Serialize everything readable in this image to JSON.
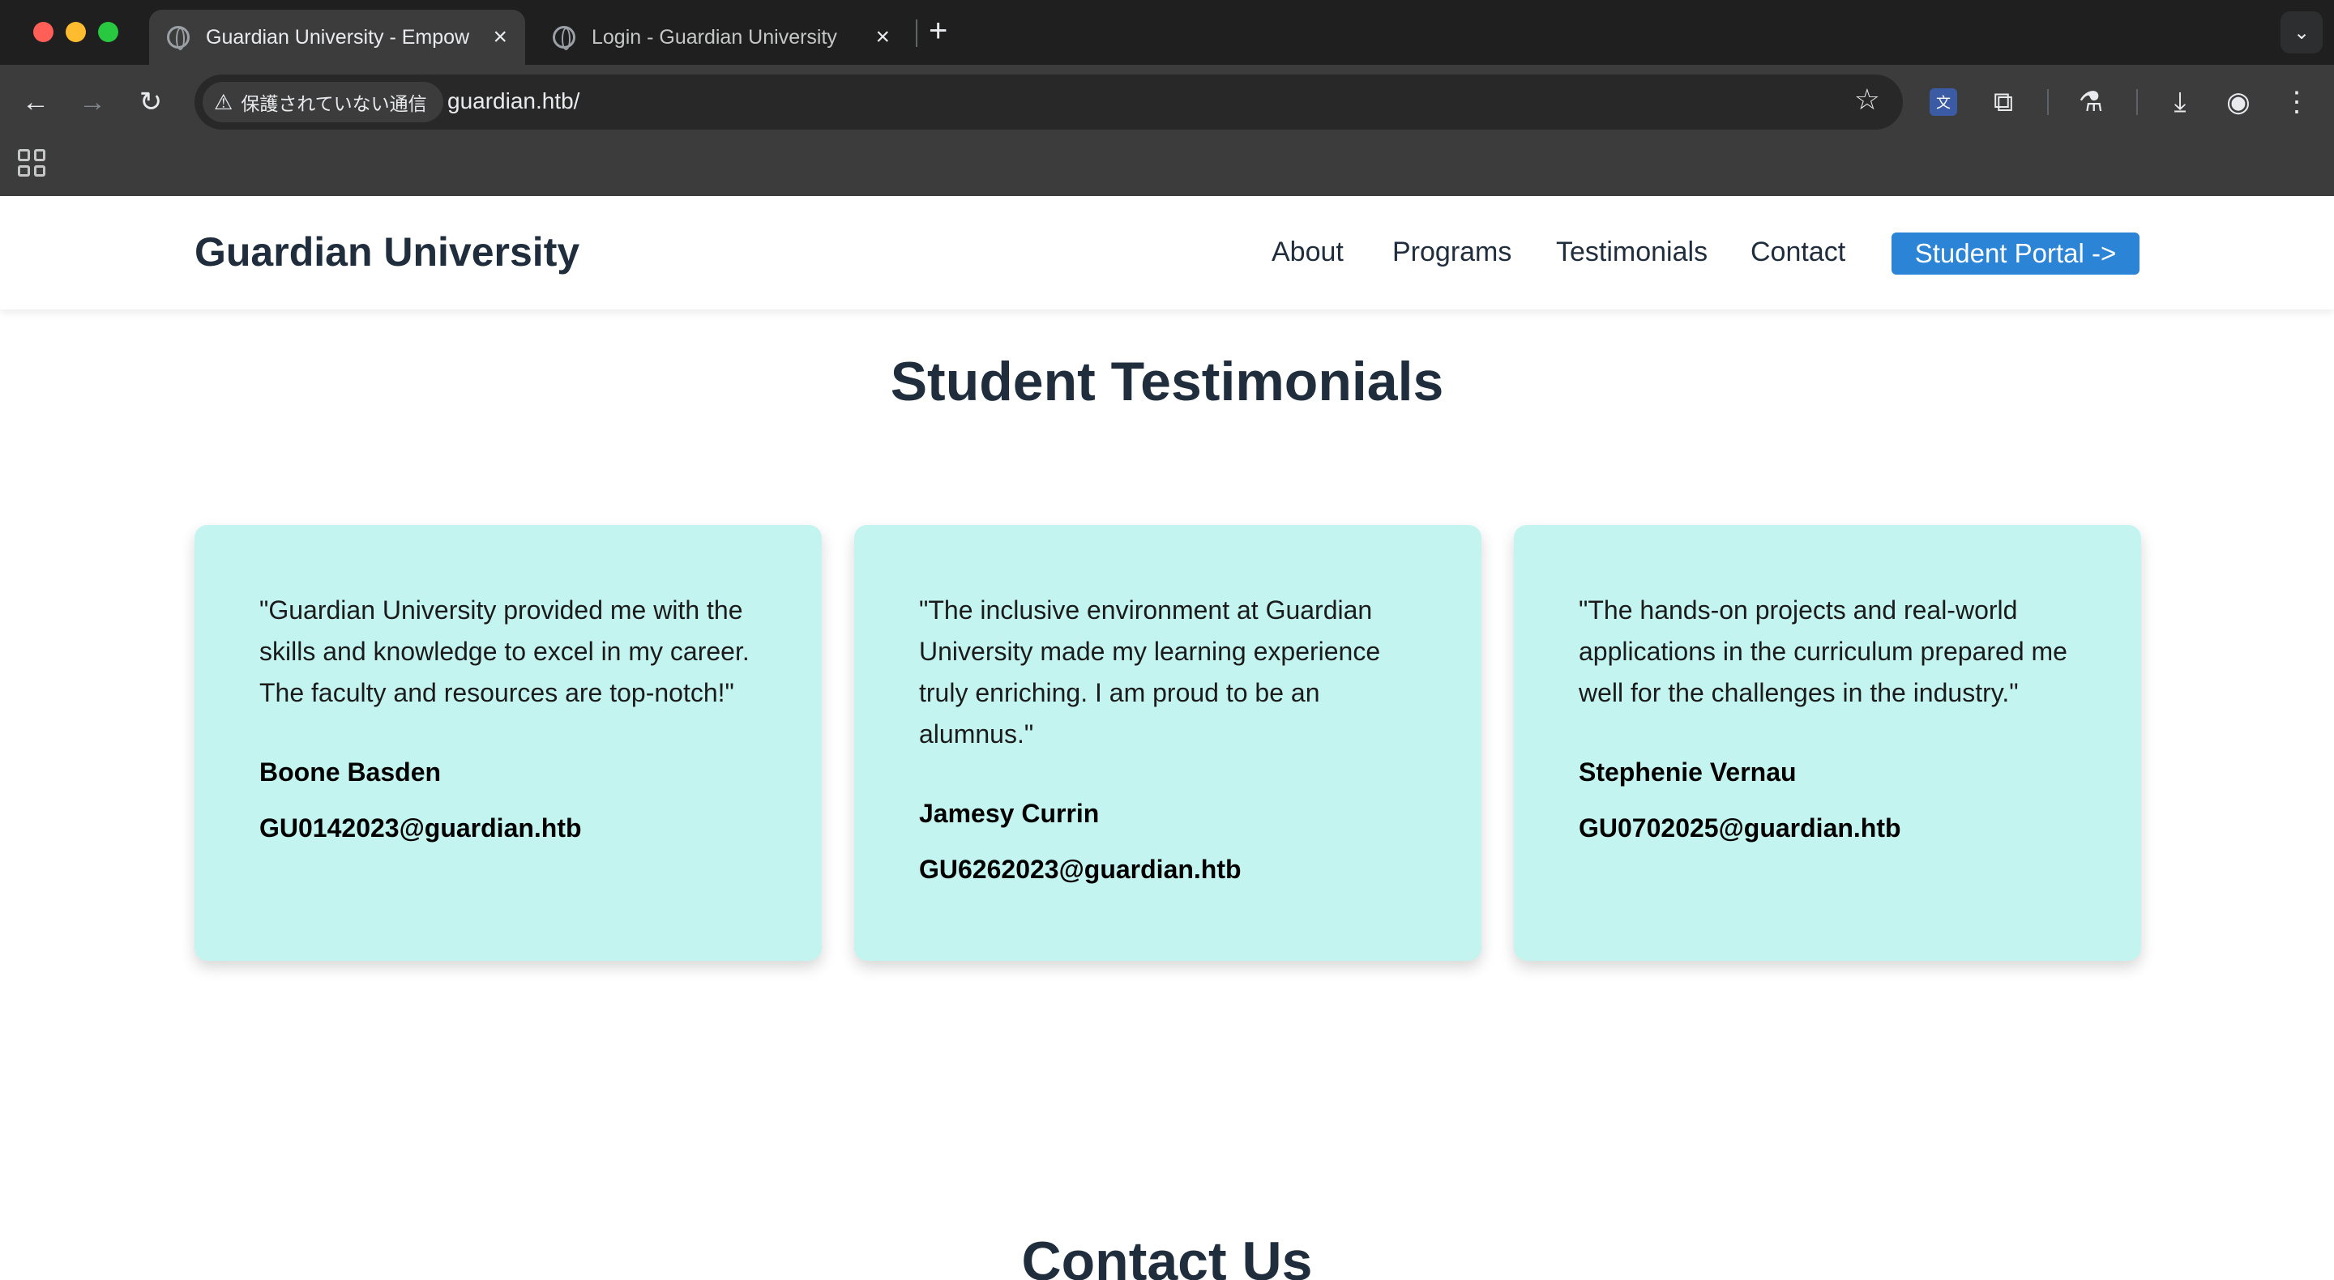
{
  "browser": {
    "tabs": [
      {
        "title": "Guardian University - Empow",
        "active": true
      },
      {
        "title": "Login - Guardian University",
        "active": false
      }
    ],
    "new_tab_label": "+",
    "tab_search_label": "⌄",
    "security_label": "保護されていない通信",
    "url": "guardian.htb/",
    "icons": [
      "back-icon",
      "forward-icon",
      "reload-icon",
      "star-icon",
      "extension-icon",
      "puzzle-icon",
      "labs-icon",
      "download-icon",
      "profile-icon",
      "menu-icon",
      "apps-icon"
    ]
  },
  "site": {
    "brand": "Guardian University",
    "nav": [
      "About",
      "Programs",
      "Testimonials",
      "Contact"
    ],
    "portal_button": "Student Portal ->",
    "colors": {
      "accent": "#2b84d6",
      "card_bg": "#c4f4f0",
      "heading": "#1f2d3d"
    }
  },
  "testimonials": {
    "title": "Student Testimonials",
    "items": [
      {
        "quote": "\"Guardian University provided me with the skills and knowledge to excel in my career. The faculty and resources are top-notch!\"",
        "name": "Boone Basden",
        "email": "GU0142023@guardian.htb"
      },
      {
        "quote": "\"The inclusive environment at Guardian University made my learning experience truly enriching. I am proud to be an alumnus.\"",
        "name": "Jamesy Currin",
        "email": "GU6262023@guardian.htb"
      },
      {
        "quote": "\"The hands-on projects and real-world applications in the curriculum prepared me well for the challenges in the industry.\"",
        "name": "Stephenie Vernau",
        "email": "GU0702025@guardian.htb"
      }
    ]
  },
  "contact": {
    "title": "Contact Us"
  }
}
